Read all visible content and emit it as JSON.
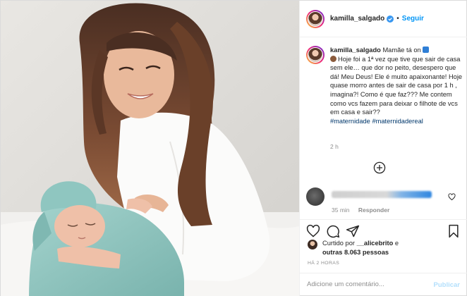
{
  "header": {
    "username": "kamilla_salgado",
    "separator": "•",
    "follow_label": "Seguir"
  },
  "caption": {
    "username": "kamilla_salgado",
    "line1": "Mamãe tá on",
    "body": "Hoje foi a 1ª vez que tive que sair de casa sem ele… que dor no peito, desespero que dá! Meu Deus! Ele é muito apaixonante! Hoje quase morro antes de sair de casa por 1 h , imagina?! Como é que faz??? Me contem como vcs fazem para deixar o filhote de vcs em casa e sair??",
    "hashtag1": "#maternidade",
    "hashtag2": "#maternidadereal",
    "time": "2 h"
  },
  "comment": {
    "time": "35 min",
    "reply_label": "Responder"
  },
  "likes": {
    "prefix": "Curtido por",
    "user": "__alicebrito",
    "connector": "e",
    "others": "outras 8.063 pessoas"
  },
  "posted_ago": "HÁ 2 HORAS",
  "add_comment": {
    "placeholder": "Adicione um comentário...",
    "publish_label": "Publicar"
  },
  "icons": {
    "verified": "verified-badge-icon",
    "load_more": "plus-circle-icon",
    "comment_like": "heart-icon",
    "like": "heart-icon",
    "comment": "comment-bubble-icon",
    "share": "paper-plane-icon",
    "save": "bookmark-icon"
  },
  "colors": {
    "accent_blue": "#0095f6",
    "hashtag": "#00376b",
    "secondary_text": "#8e8e8e",
    "publish_disabled": "#b2dffc",
    "baby_wrap": "#8fc6c0"
  }
}
